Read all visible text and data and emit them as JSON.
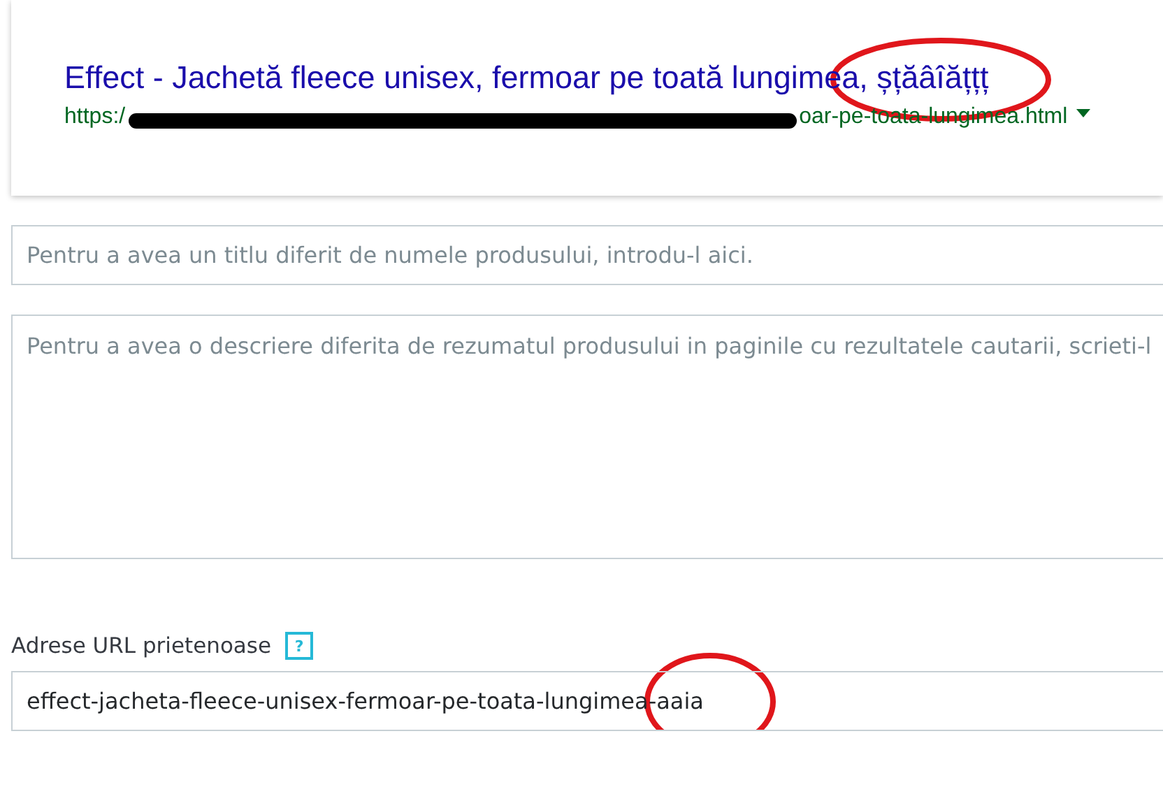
{
  "preview": {
    "title": "Effect - Jachetă fleece unisex, fermoar pe toată lungimea, șțăâîățțț",
    "url_start": "https:/",
    "url_end": "oar-pe-toata-lungimea.html",
    "url_redacted": true
  },
  "meta_title": {
    "placeholder": "Pentru a avea un titlu diferit de numele produsului, introdu-l aici."
  },
  "meta_description": {
    "placeholder": "Pentru a avea o descriere diferita de rezumatul produsului in paginile cu rezultatele cautarii, scrieti-l"
  },
  "friendly_url": {
    "label": "Adrese URL prietenoase",
    "help": "?",
    "value": "effect-jacheta-fleece-unisex-fermoar-pe-toata-lungimea-aaia"
  }
}
